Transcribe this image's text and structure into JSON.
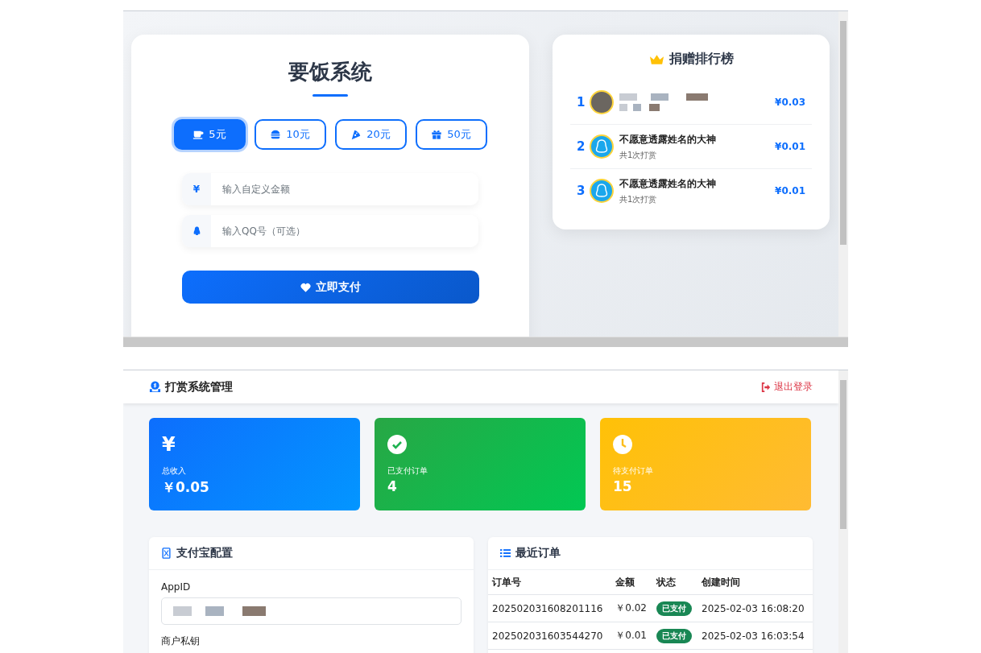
{
  "payment_page": {
    "title": "要饭系统",
    "amount_options": [
      {
        "label": "5元",
        "selected": true
      },
      {
        "label": "10元",
        "selected": false
      },
      {
        "label": "20元",
        "selected": false
      },
      {
        "label": "50元",
        "selected": false
      }
    ],
    "custom_amount": {
      "prefix": "¥",
      "placeholder": "输入自定义金额"
    },
    "qq_field": {
      "placeholder": "输入QQ号（可选）"
    },
    "pay_button": "立即支付"
  },
  "leaderboard": {
    "title": "捐赠排行榜",
    "entries": [
      {
        "rank": "1",
        "amount": "¥0.03"
      },
      {
        "rank": "2",
        "name": "不愿意透露姓名的大神",
        "count": "共1次打赏",
        "amount": "¥0.01"
      },
      {
        "rank": "3",
        "name": "不愿意透露姓名的大神",
        "count": "共1次打赏",
        "amount": "¥0.01"
      }
    ]
  },
  "admin": {
    "title": "打赏系统管理",
    "logout": "退出登录",
    "stats": [
      {
        "kind": "income",
        "icon_text": "¥",
        "label": "总收入",
        "value": "￥0.05"
      },
      {
        "kind": "paid",
        "label": "已支付订单",
        "value": "4"
      },
      {
        "kind": "pending",
        "label": "待支付订单",
        "value": "15"
      }
    ],
    "alipay_config": {
      "title": "支付宝配置",
      "fields": [
        {
          "label": "AppID"
        },
        {
          "label": "商户私钥"
        }
      ]
    },
    "recent_orders": {
      "title": "最近订单",
      "columns": [
        "订单号",
        "金额",
        "状态",
        "创建时间"
      ],
      "rows": [
        {
          "order_no": "202502031608201116",
          "amount": "￥0.02",
          "status": "已支付",
          "kind": "paid",
          "time": "2025-02-03 16:08:20"
        },
        {
          "order_no": "202502031603544270",
          "amount": "￥0.01",
          "status": "已支付",
          "kind": "paid",
          "time": "2025-02-03 16:03:54"
        }
      ]
    }
  }
}
